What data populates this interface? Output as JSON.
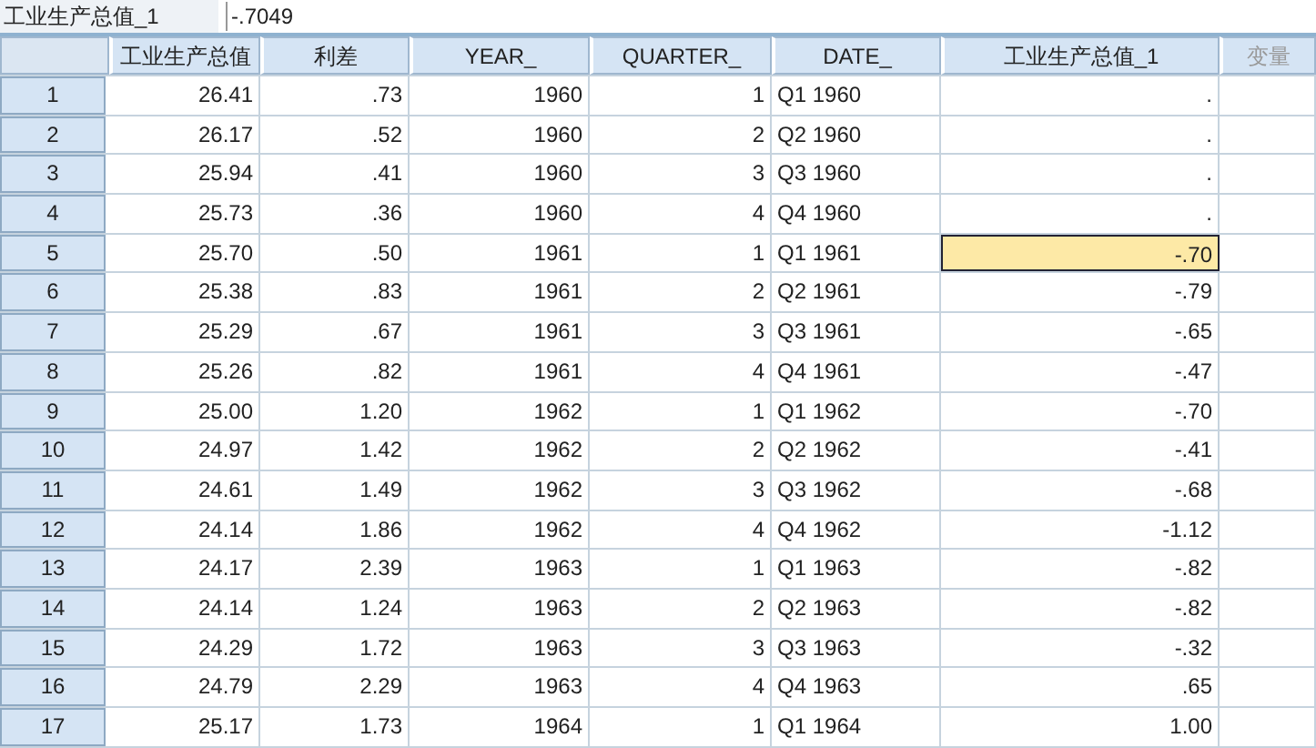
{
  "cell_editor": {
    "name": "工业生产总值_1",
    "value": "-.7049"
  },
  "columns": [
    {
      "label": "工业生产总值",
      "kind": "numeric"
    },
    {
      "label": "利差",
      "kind": "numeric"
    },
    {
      "label": "YEAR_",
      "kind": "numeric"
    },
    {
      "label": "QUARTER_",
      "kind": "numeric"
    },
    {
      "label": "DATE_",
      "kind": "string"
    },
    {
      "label": "工业生产总值_1",
      "kind": "numeric"
    },
    {
      "label": "变量",
      "kind": "placeholder"
    }
  ],
  "rows": [
    {
      "label": "1",
      "cells": [
        {
          "text": "26.41",
          "selected": false
        },
        {
          "text": ".73",
          "selected": false
        },
        {
          "text": "1960",
          "selected": false
        },
        {
          "text": "1",
          "selected": false
        },
        {
          "text": "Q1 1960",
          "selected": false
        },
        {
          "text": ".",
          "selected": false
        }
      ]
    },
    {
      "label": "2",
      "cells": [
        {
          "text": "26.17",
          "selected": false
        },
        {
          "text": ".52",
          "selected": false
        },
        {
          "text": "1960",
          "selected": false
        },
        {
          "text": "2",
          "selected": false
        },
        {
          "text": "Q2 1960",
          "selected": false
        },
        {
          "text": ".",
          "selected": false
        }
      ]
    },
    {
      "label": "3",
      "cells": [
        {
          "text": "25.94",
          "selected": false
        },
        {
          "text": ".41",
          "selected": false
        },
        {
          "text": "1960",
          "selected": false
        },
        {
          "text": "3",
          "selected": false
        },
        {
          "text": "Q3 1960",
          "selected": false
        },
        {
          "text": ".",
          "selected": false
        }
      ]
    },
    {
      "label": "4",
      "cells": [
        {
          "text": "25.73",
          "selected": false
        },
        {
          "text": ".36",
          "selected": false
        },
        {
          "text": "1960",
          "selected": false
        },
        {
          "text": "4",
          "selected": false
        },
        {
          "text": "Q4 1960",
          "selected": false
        },
        {
          "text": ".",
          "selected": false
        }
      ]
    },
    {
      "label": "5",
      "cells": [
        {
          "text": "25.70",
          "selected": false
        },
        {
          "text": ".50",
          "selected": false
        },
        {
          "text": "1961",
          "selected": false
        },
        {
          "text": "1",
          "selected": false
        },
        {
          "text": "Q1 1961",
          "selected": false
        },
        {
          "text": "-.70",
          "selected": true
        }
      ]
    },
    {
      "label": "6",
      "cells": [
        {
          "text": "25.38",
          "selected": false
        },
        {
          "text": ".83",
          "selected": false
        },
        {
          "text": "1961",
          "selected": false
        },
        {
          "text": "2",
          "selected": false
        },
        {
          "text": "Q2 1961",
          "selected": false
        },
        {
          "text": "-.79",
          "selected": false
        }
      ]
    },
    {
      "label": "7",
      "cells": [
        {
          "text": "25.29",
          "selected": false
        },
        {
          "text": ".67",
          "selected": false
        },
        {
          "text": "1961",
          "selected": false
        },
        {
          "text": "3",
          "selected": false
        },
        {
          "text": "Q3 1961",
          "selected": false
        },
        {
          "text": "-.65",
          "selected": false
        }
      ]
    },
    {
      "label": "8",
      "cells": [
        {
          "text": "25.26",
          "selected": false
        },
        {
          "text": ".82",
          "selected": false
        },
        {
          "text": "1961",
          "selected": false
        },
        {
          "text": "4",
          "selected": false
        },
        {
          "text": "Q4 1961",
          "selected": false
        },
        {
          "text": "-.47",
          "selected": false
        }
      ]
    },
    {
      "label": "9",
      "cells": [
        {
          "text": "25.00",
          "selected": false
        },
        {
          "text": "1.20",
          "selected": false
        },
        {
          "text": "1962",
          "selected": false
        },
        {
          "text": "1",
          "selected": false
        },
        {
          "text": "Q1 1962",
          "selected": false
        },
        {
          "text": "-.70",
          "selected": false
        }
      ]
    },
    {
      "label": "10",
      "cells": [
        {
          "text": "24.97",
          "selected": false
        },
        {
          "text": "1.42",
          "selected": false
        },
        {
          "text": "1962",
          "selected": false
        },
        {
          "text": "2",
          "selected": false
        },
        {
          "text": "Q2 1962",
          "selected": false
        },
        {
          "text": "-.41",
          "selected": false
        }
      ]
    },
    {
      "label": "11",
      "cells": [
        {
          "text": "24.61",
          "selected": false
        },
        {
          "text": "1.49",
          "selected": false
        },
        {
          "text": "1962",
          "selected": false
        },
        {
          "text": "3",
          "selected": false
        },
        {
          "text": "Q3 1962",
          "selected": false
        },
        {
          "text": "-.68",
          "selected": false
        }
      ]
    },
    {
      "label": "12",
      "cells": [
        {
          "text": "24.14",
          "selected": false
        },
        {
          "text": "1.86",
          "selected": false
        },
        {
          "text": "1962",
          "selected": false
        },
        {
          "text": "4",
          "selected": false
        },
        {
          "text": "Q4 1962",
          "selected": false
        },
        {
          "text": "-1.12",
          "selected": false
        }
      ]
    },
    {
      "label": "13",
      "cells": [
        {
          "text": "24.17",
          "selected": false
        },
        {
          "text": "2.39",
          "selected": false
        },
        {
          "text": "1963",
          "selected": false
        },
        {
          "text": "1",
          "selected": false
        },
        {
          "text": "Q1 1963",
          "selected": false
        },
        {
          "text": "-.82",
          "selected": false
        }
      ]
    },
    {
      "label": "14",
      "cells": [
        {
          "text": "24.14",
          "selected": false
        },
        {
          "text": "1.24",
          "selected": false
        },
        {
          "text": "1963",
          "selected": false
        },
        {
          "text": "2",
          "selected": false
        },
        {
          "text": "Q2 1963",
          "selected": false
        },
        {
          "text": "-.82",
          "selected": false
        }
      ]
    },
    {
      "label": "15",
      "cells": [
        {
          "text": "24.29",
          "selected": false
        },
        {
          "text": "1.72",
          "selected": false
        },
        {
          "text": "1963",
          "selected": false
        },
        {
          "text": "3",
          "selected": false
        },
        {
          "text": "Q3 1963",
          "selected": false
        },
        {
          "text": "-.32",
          "selected": false
        }
      ]
    },
    {
      "label": "16",
      "cells": [
        {
          "text": "24.79",
          "selected": false
        },
        {
          "text": "2.29",
          "selected": false
        },
        {
          "text": "1963",
          "selected": false
        },
        {
          "text": "4",
          "selected": false
        },
        {
          "text": "Q4 1963",
          "selected": false
        },
        {
          "text": ".65",
          "selected": false
        }
      ]
    },
    {
      "label": "17",
      "cells": [
        {
          "text": "25.17",
          "selected": false
        },
        {
          "text": "1.73",
          "selected": false
        },
        {
          "text": "1964",
          "selected": false
        },
        {
          "text": "1",
          "selected": false
        },
        {
          "text": "Q1 1964",
          "selected": false
        },
        {
          "text": "1.00",
          "selected": false
        }
      ]
    }
  ]
}
